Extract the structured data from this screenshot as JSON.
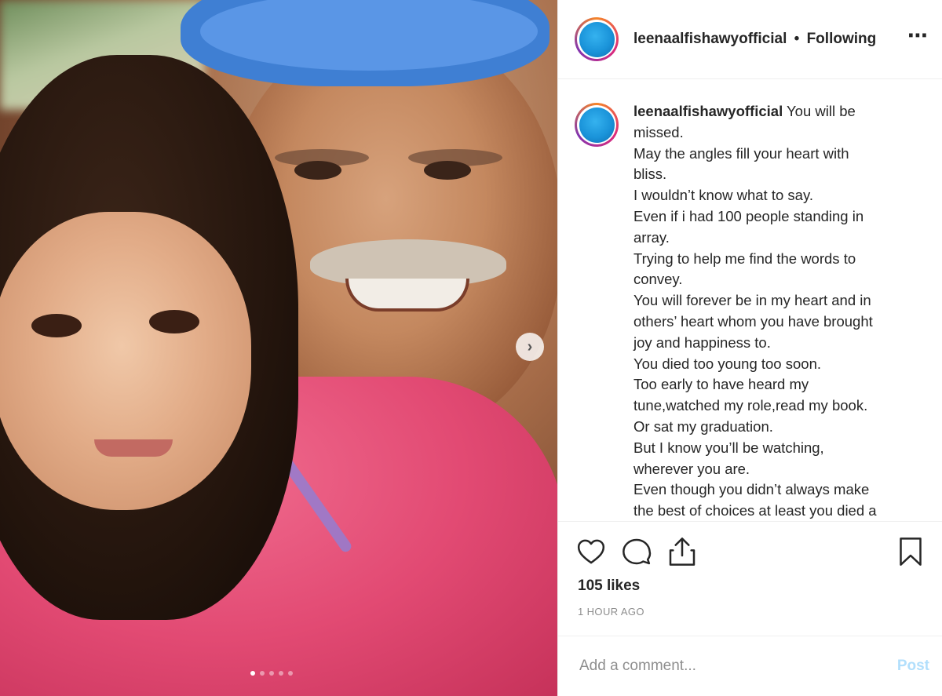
{
  "post": {
    "username": "leenaalfishawyofficial",
    "separator": "•",
    "follow_state": "Following",
    "more_icon": "⋯",
    "photo": {
      "next_icon": "›",
      "carousel_total": 5,
      "carousel_active": 1
    },
    "caption": {
      "username": "leenaalfishawyofficial",
      "lines": [
        "You will be",
        "missed.",
        "May the angles fill your heart with",
        "bliss.",
        "I wouldn’t know what to say.",
        "Even if i had 100 people standing in",
        "array.",
        "Trying to help me find the words to",
        "convey.",
        "You will forever be in my heart and in",
        "others’ heart whom you have brought",
        "joy and happiness to.",
        "You died too young too soon.",
        "Too early to have heard my",
        "tune,watched my role,read my book.",
        "Or sat my graduation.",
        "But I know you’ll be watching,",
        "wherever you are.",
        "Even though you didn’t always make",
        "the best of choices at least you died a"
      ]
    },
    "likes": "105 likes",
    "time_ago": "1 HOUR AGO",
    "comment_placeholder": "Add a comment...",
    "post_label": "Post"
  }
}
